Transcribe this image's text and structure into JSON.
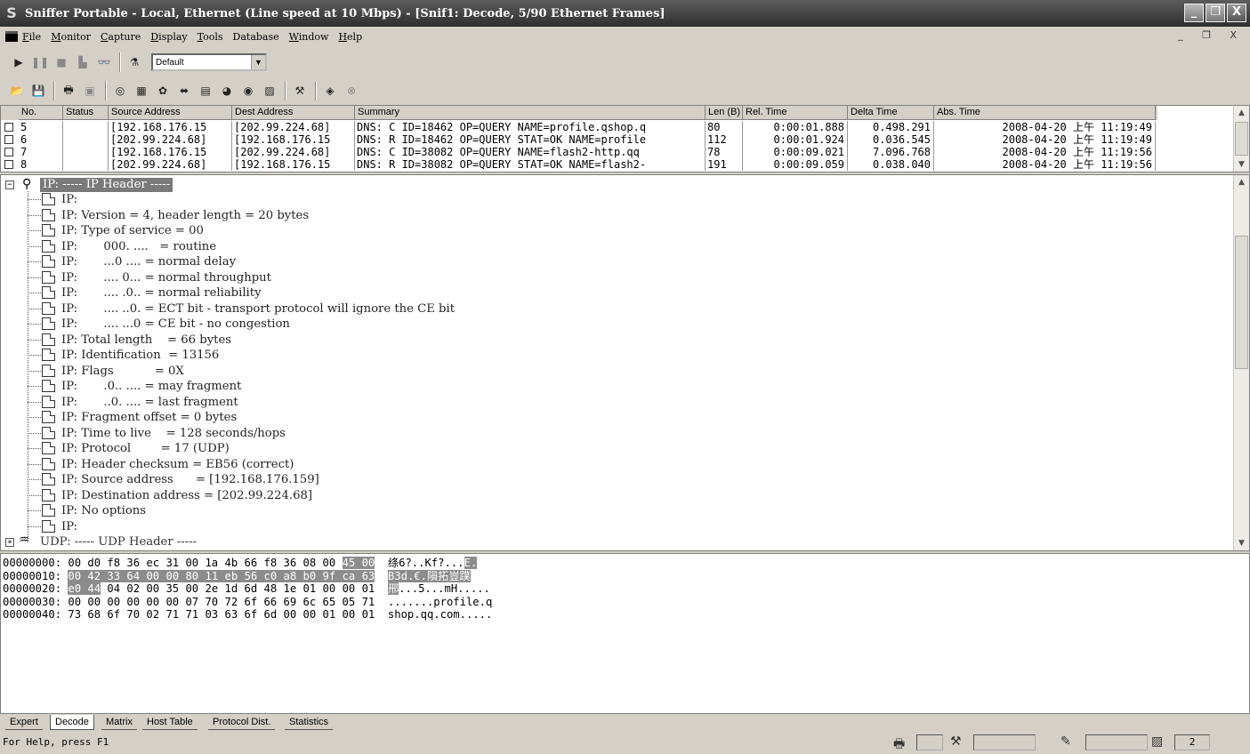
{
  "window": {
    "title": "Sniffer Portable - Local, Ethernet (Line speed at 10 Mbps) - [Snif1: Decode, 5/90 Ethernet Frames]",
    "minimize": "_",
    "maximize": "❐",
    "close": "X"
  },
  "menu": {
    "items": [
      {
        "u": "F",
        "rest": "ile"
      },
      {
        "u": "M",
        "rest": "onitor"
      },
      {
        "u": "C",
        "rest": "apture"
      },
      {
        "u": "D",
        "rest": "isplay"
      },
      {
        "u": "T",
        "rest": "ools"
      },
      {
        "u": "",
        "rest": "Database"
      },
      {
        "u": "W",
        "rest": "indow"
      },
      {
        "u": "H",
        "rest": "elp"
      }
    ],
    "mdi_buttons": "_ ❐ X"
  },
  "toolbar": {
    "profile": "Default"
  },
  "summary": {
    "columns": [
      "No.",
      "Status",
      "Source Address",
      "Dest Address",
      "Summary",
      "Len (B)",
      "Rel. Time",
      "Delta Time",
      "Abs. Time"
    ],
    "rows": [
      [
        "5",
        "",
        "[192.168.176.15",
        "[202.99.224.68]",
        "DNS: C ID=18462 OP=QUERY NAME=profile.qshop.q",
        "80",
        "0:00:01.888",
        "0.498.291",
        "2008-04-20 上午 11:19:49"
      ],
      [
        "6",
        "",
        "[202.99.224.68]",
        "[192.168.176.15",
        "DNS: R ID=18462 OP=QUERY STAT=OK NAME=profile",
        "112",
        "0:00:01.924",
        "0.036.545",
        "2008-04-20 上午 11:19:49"
      ],
      [
        "7",
        "",
        "[192.168.176.15",
        "[202.99.224.68]",
        "DNS: C ID=38082 OP=QUERY NAME=flash2-http.qq",
        "78",
        "0:00:09.021",
        "7.096.768",
        "2008-04-20 上午 11:19:56"
      ],
      [
        "8",
        "",
        "[202.99.224.68]",
        "[192.168.176.15",
        "DNS: R ID=38082 OP=QUERY STAT=OK NAME=flash2-",
        "191",
        "0:00:09.059",
        "0.038.040",
        "2008-04-20 上午 11:19:56"
      ]
    ]
  },
  "decode": {
    "ip_header": "IP: ----- IP Header -----",
    "lines": [
      "IP:",
      "IP: Version = 4, header length = 20 bytes",
      "IP: Type of service = 00",
      "IP:       000. ....   = routine",
      "IP:       ...0 .... = normal delay",
      "IP:       .... 0... = normal throughput",
      "IP:       .... .0.. = normal reliability",
      "IP:       .... ..0. = ECT bit - transport protocol will ignore the CE bit",
      "IP:       .... ...0 = CE bit - no congestion",
      "IP: Total length    = 66 bytes",
      "IP: Identification  = 13156",
      "IP: Flags           = 0X",
      "IP:       .0.. .... = may fragment",
      "IP:       ..0. .... = last fragment",
      "IP: Fragment offset = 0 bytes",
      "IP: Time to live    = 128 seconds/hops",
      "IP: Protocol        = 17 (UDP)",
      "IP: Header checksum = EB56 (correct)",
      "IP: Source address      = [192.168.176.159]",
      "IP: Destination address = [202.99.224.68]",
      "IP: No options",
      "IP:"
    ],
    "udp_header": "UDP: ----- UDP Header -----"
  },
  "hex": {
    "lines": [
      {
        "off": "00000000:",
        "pre": " 00 d0 f8 36 ec 31 00 1a 4b 66 f8 36 08 00 ",
        "sel": "45 00",
        "post": "  ",
        "ascii_pre": "绦6?..Kf?...",
        "ascii_sel": "E."
      },
      {
        "off": "00000010:",
        "pre": " ",
        "sel": "00 42 33 64 00 00 80 11 eb 56 c0 a8 b0 9f ca 63",
        "post": "  ",
        "ascii_pre": "",
        "ascii_sel": "B3d.€.隕拓豈蹼"
      },
      {
        "off": "00000020:",
        "pre": " ",
        "sel": "e0 44",
        "post": " 04 02 00 35 00 2e 1d 6d 48 1e 01 00 00 01  ",
        "ascii_pre": "",
        "ascii_sel": "郉",
        "ascii_post": "...5...mH....."
      },
      {
        "off": "00000030:",
        "pre": " 00 00 00 00 00 00 07 70 72 6f 66 69 6c 65 05 71  ",
        "sel": "",
        "post": "",
        "ascii_pre": ".......profile.q",
        "ascii_sel": ""
      },
      {
        "off": "00000040:",
        "pre": " 73 68 6f 70 02 71 71 03 63 6f 6d 00 00 01 00 01  ",
        "sel": "",
        "post": "",
        "ascii_pre": "shop.qq.com.....",
        "ascii_sel": ""
      }
    ]
  },
  "tabs": [
    "Expert",
    "Decode",
    "Matrix",
    "Host Table",
    "Protocol Dist.",
    "Statistics"
  ],
  "status": {
    "help": "For Help, press F1",
    "count": "2"
  }
}
